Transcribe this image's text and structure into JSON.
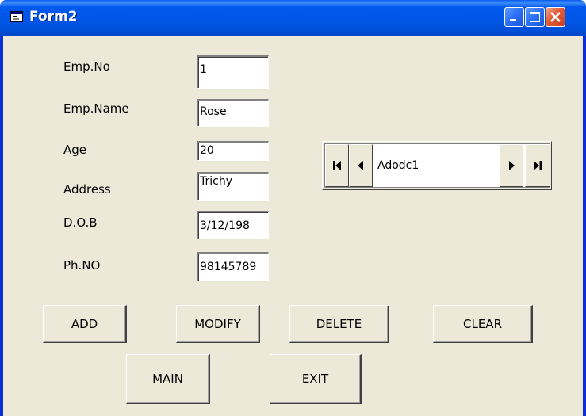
{
  "window": {
    "title": "Form2"
  },
  "form": {
    "fields": [
      {
        "label": "Emp.No",
        "value": "1"
      },
      {
        "label": "Emp.Name",
        "value": "Rose"
      },
      {
        "label": "Age",
        "value": "20"
      },
      {
        "label": "Address",
        "value": "Trichy"
      },
      {
        "label": "D.O.B",
        "value": "3/12/198"
      },
      {
        "label": "Ph.NO",
        "value": "98145789"
      }
    ]
  },
  "adodc": {
    "caption": "Adodc1"
  },
  "buttons": {
    "add": "ADD",
    "modify": "MODIFY",
    "delete": "DELETE",
    "clear": "CLEAR",
    "main": "MAIN",
    "exit": "EXIT"
  }
}
